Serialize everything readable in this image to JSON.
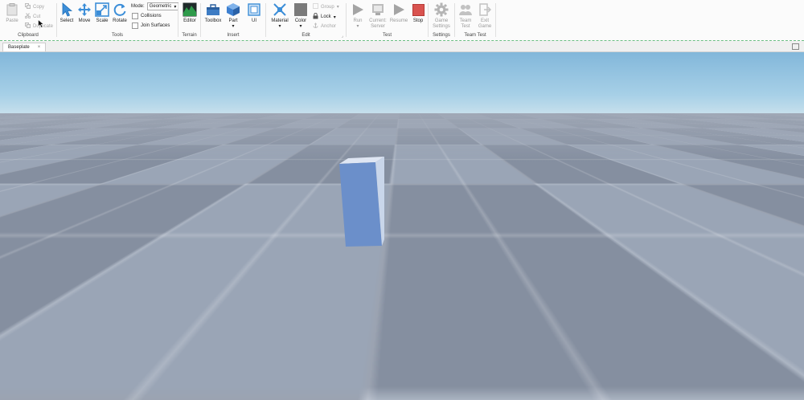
{
  "ribbon": {
    "clipboard": {
      "label": "Clipboard",
      "paste": "Paste",
      "copy": "Copy",
      "cut": "Cut",
      "duplicate": "Duplicate"
    },
    "tools": {
      "label": "Tools",
      "select": "Select",
      "move": "Move",
      "scale": "Scale",
      "rotate": "Rotate",
      "mode_label": "Mode:",
      "mode_value": "Geometric",
      "collisions": "Collisions",
      "join_surfaces": "Join Surfaces"
    },
    "terrain": {
      "label": "Terrain",
      "editor": "Editor"
    },
    "insert": {
      "label": "Insert",
      "toolbox": "Toolbox",
      "part": "Part",
      "ui": "UI"
    },
    "edit": {
      "label": "Edit",
      "material": "Material",
      "color": "Color",
      "group": "Group",
      "lock": "Lock",
      "anchor": "Anchor"
    },
    "test": {
      "label": "Test",
      "run": "Run",
      "current_server": "Current: Server",
      "resume": "Resume",
      "stop": "Stop"
    },
    "settings": {
      "label": "Settings",
      "game_settings": "Game Settings"
    },
    "team_test": {
      "label": "Team Test",
      "team_test": "Team Test",
      "exit_game": "Exit Game"
    }
  },
  "tabs": [
    {
      "label": "Baseplate",
      "close": "×"
    }
  ],
  "colors": {
    "accent_blue": "#3c8ed8",
    "stop_red": "#d9534f",
    "part_blue": "#6b8fca",
    "terrain_green": "#2e9a4a"
  }
}
